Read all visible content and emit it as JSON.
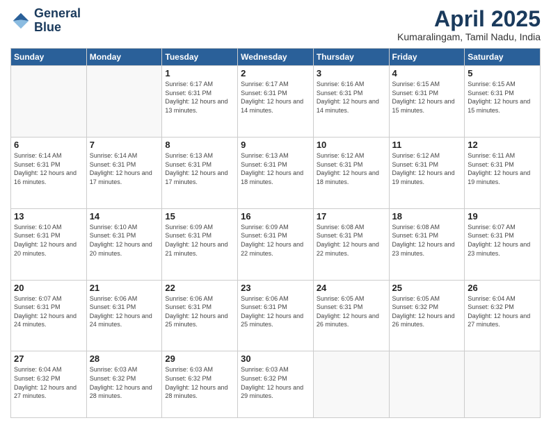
{
  "logo": {
    "line1": "General",
    "line2": "Blue"
  },
  "title": "April 2025",
  "location": "Kumaralingam, Tamil Nadu, India",
  "days_of_week": [
    "Sunday",
    "Monday",
    "Tuesday",
    "Wednesday",
    "Thursday",
    "Friday",
    "Saturday"
  ],
  "weeks": [
    [
      {
        "day": "",
        "info": ""
      },
      {
        "day": "",
        "info": ""
      },
      {
        "day": "1",
        "info": "Sunrise: 6:17 AM\nSunset: 6:31 PM\nDaylight: 12 hours\nand 13 minutes."
      },
      {
        "day": "2",
        "info": "Sunrise: 6:17 AM\nSunset: 6:31 PM\nDaylight: 12 hours\nand 14 minutes."
      },
      {
        "day": "3",
        "info": "Sunrise: 6:16 AM\nSunset: 6:31 PM\nDaylight: 12 hours\nand 14 minutes."
      },
      {
        "day": "4",
        "info": "Sunrise: 6:15 AM\nSunset: 6:31 PM\nDaylight: 12 hours\nand 15 minutes."
      },
      {
        "day": "5",
        "info": "Sunrise: 6:15 AM\nSunset: 6:31 PM\nDaylight: 12 hours\nand 15 minutes."
      }
    ],
    [
      {
        "day": "6",
        "info": "Sunrise: 6:14 AM\nSunset: 6:31 PM\nDaylight: 12 hours\nand 16 minutes."
      },
      {
        "day": "7",
        "info": "Sunrise: 6:14 AM\nSunset: 6:31 PM\nDaylight: 12 hours\nand 17 minutes."
      },
      {
        "day": "8",
        "info": "Sunrise: 6:13 AM\nSunset: 6:31 PM\nDaylight: 12 hours\nand 17 minutes."
      },
      {
        "day": "9",
        "info": "Sunrise: 6:13 AM\nSunset: 6:31 PM\nDaylight: 12 hours\nand 18 minutes."
      },
      {
        "day": "10",
        "info": "Sunrise: 6:12 AM\nSunset: 6:31 PM\nDaylight: 12 hours\nand 18 minutes."
      },
      {
        "day": "11",
        "info": "Sunrise: 6:12 AM\nSunset: 6:31 PM\nDaylight: 12 hours\nand 19 minutes."
      },
      {
        "day": "12",
        "info": "Sunrise: 6:11 AM\nSunset: 6:31 PM\nDaylight: 12 hours\nand 19 minutes."
      }
    ],
    [
      {
        "day": "13",
        "info": "Sunrise: 6:10 AM\nSunset: 6:31 PM\nDaylight: 12 hours\nand 20 minutes."
      },
      {
        "day": "14",
        "info": "Sunrise: 6:10 AM\nSunset: 6:31 PM\nDaylight: 12 hours\nand 20 minutes."
      },
      {
        "day": "15",
        "info": "Sunrise: 6:09 AM\nSunset: 6:31 PM\nDaylight: 12 hours\nand 21 minutes."
      },
      {
        "day": "16",
        "info": "Sunrise: 6:09 AM\nSunset: 6:31 PM\nDaylight: 12 hours\nand 22 minutes."
      },
      {
        "day": "17",
        "info": "Sunrise: 6:08 AM\nSunset: 6:31 PM\nDaylight: 12 hours\nand 22 minutes."
      },
      {
        "day": "18",
        "info": "Sunrise: 6:08 AM\nSunset: 6:31 PM\nDaylight: 12 hours\nand 23 minutes."
      },
      {
        "day": "19",
        "info": "Sunrise: 6:07 AM\nSunset: 6:31 PM\nDaylight: 12 hours\nand 23 minutes."
      }
    ],
    [
      {
        "day": "20",
        "info": "Sunrise: 6:07 AM\nSunset: 6:31 PM\nDaylight: 12 hours\nand 24 minutes."
      },
      {
        "day": "21",
        "info": "Sunrise: 6:06 AM\nSunset: 6:31 PM\nDaylight: 12 hours\nand 24 minutes."
      },
      {
        "day": "22",
        "info": "Sunrise: 6:06 AM\nSunset: 6:31 PM\nDaylight: 12 hours\nand 25 minutes."
      },
      {
        "day": "23",
        "info": "Sunrise: 6:06 AM\nSunset: 6:31 PM\nDaylight: 12 hours\nand 25 minutes."
      },
      {
        "day": "24",
        "info": "Sunrise: 6:05 AM\nSunset: 6:31 PM\nDaylight: 12 hours\nand 26 minutes."
      },
      {
        "day": "25",
        "info": "Sunrise: 6:05 AM\nSunset: 6:32 PM\nDaylight: 12 hours\nand 26 minutes."
      },
      {
        "day": "26",
        "info": "Sunrise: 6:04 AM\nSunset: 6:32 PM\nDaylight: 12 hours\nand 27 minutes."
      }
    ],
    [
      {
        "day": "27",
        "info": "Sunrise: 6:04 AM\nSunset: 6:32 PM\nDaylight: 12 hours\nand 27 minutes."
      },
      {
        "day": "28",
        "info": "Sunrise: 6:03 AM\nSunset: 6:32 PM\nDaylight: 12 hours\nand 28 minutes."
      },
      {
        "day": "29",
        "info": "Sunrise: 6:03 AM\nSunset: 6:32 PM\nDaylight: 12 hours\nand 28 minutes."
      },
      {
        "day": "30",
        "info": "Sunrise: 6:03 AM\nSunset: 6:32 PM\nDaylight: 12 hours\nand 29 minutes."
      },
      {
        "day": "",
        "info": ""
      },
      {
        "day": "",
        "info": ""
      },
      {
        "day": "",
        "info": ""
      }
    ]
  ]
}
